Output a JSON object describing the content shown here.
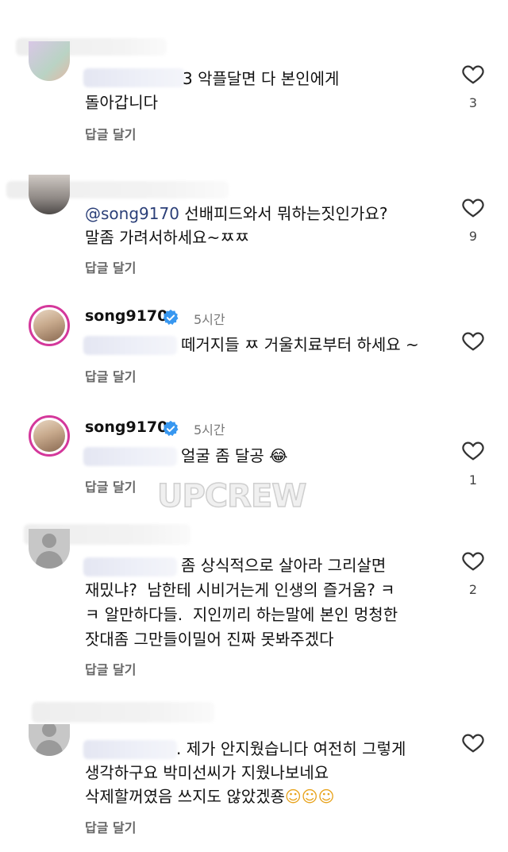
{
  "comments": [
    {
      "username": "",
      "text_line1": "3 악플달면 다 본인에게",
      "text_line2": "돌아갑니다",
      "reply": "답글 달기",
      "likes": "3"
    },
    {
      "mention": "@song9170",
      "text_line1": " 선배피드와서 뭐하는짓인가요?",
      "text_line2": "말좀 가려서하세요~ㅉㅉ",
      "reply": "답글 달기",
      "likes": "9"
    },
    {
      "username": "song9170",
      "time": "5시간",
      "text_line1": "떼거지들 ㅉ 거울치료부터 하세요 ~",
      "reply": "답글 달기",
      "likes": ""
    },
    {
      "username": "song9170",
      "time": "5시간",
      "text_line1": "얼굴 좀 달공",
      "emoji": "😂",
      "reply": "답글 달기",
      "likes": "1"
    },
    {
      "text_line1": "좀 상식적으로 살아라 그리살면",
      "text_line2": "재밌냐?  남한테 시비거는게 인생의 즐거움? ㅋ",
      "text_line3": "ㅋ 알만하다들.  지인끼리 하는말에 본인 멍청한",
      "text_line4": "잣대좀 그만들이밀어 진짜 못봐주겠다",
      "reply": "답글 달기",
      "likes": "2"
    },
    {
      "text_line1": ". 제가 안지웠습니다 여전히 그렇게",
      "text_line2": "생각하구요 박미선씨가 지웠나보네요",
      "text_line3": "삭제할꺼였음 쓰지도 않았겠죵",
      "emoji": "☺☺☺",
      "reply": "답글 달기",
      "likes": ""
    }
  ],
  "watermark": "UPCREW",
  "colors": {
    "verified": "#3797f0",
    "story_ring": "#d4389b",
    "mention": "#2b3f78"
  },
  "icons": {
    "like": "heart-outline-icon",
    "verified": "verified-badge-icon"
  }
}
